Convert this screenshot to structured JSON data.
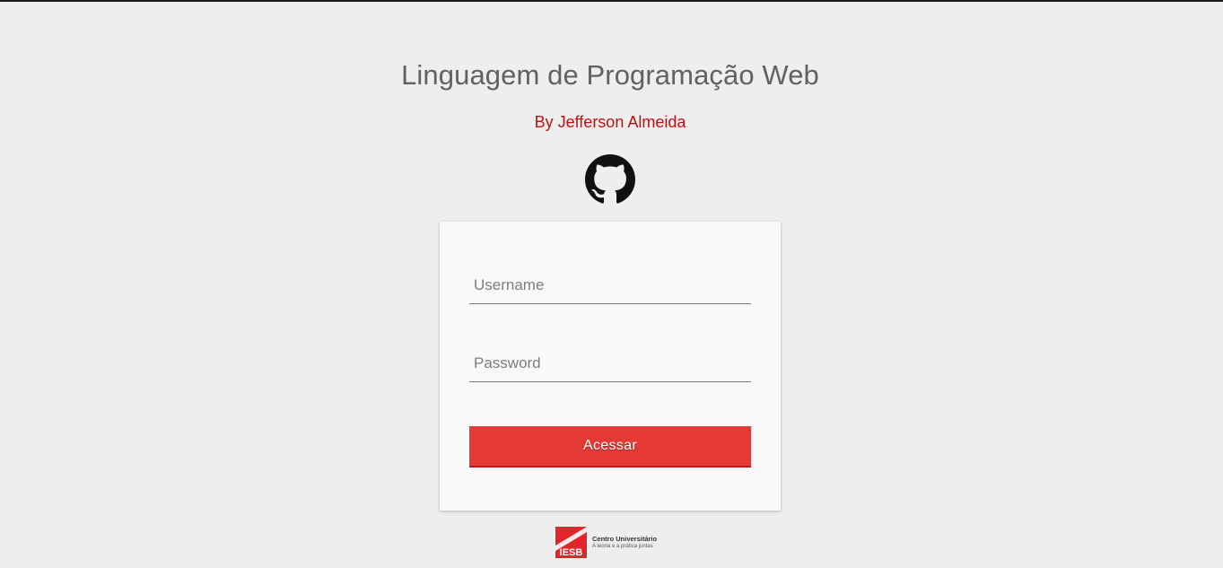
{
  "header": {
    "title": "Linguagem de Programação Web",
    "subtitle": "By Jefferson Almeida",
    "icon": "github-icon"
  },
  "login_form": {
    "username_placeholder": "Username",
    "username_value": "",
    "password_placeholder": "Password",
    "password_value": "",
    "submit_label": "Acessar"
  },
  "footer_logo": {
    "brand": "IESB",
    "name": "Centro Universitário",
    "tagline": "A teoria e a prática juntas"
  },
  "colors": {
    "background": "#eeeeee",
    "title": "#616161",
    "subtitle": "#c40f0f",
    "button": "#e53935",
    "logo_red": "#e3242b"
  }
}
